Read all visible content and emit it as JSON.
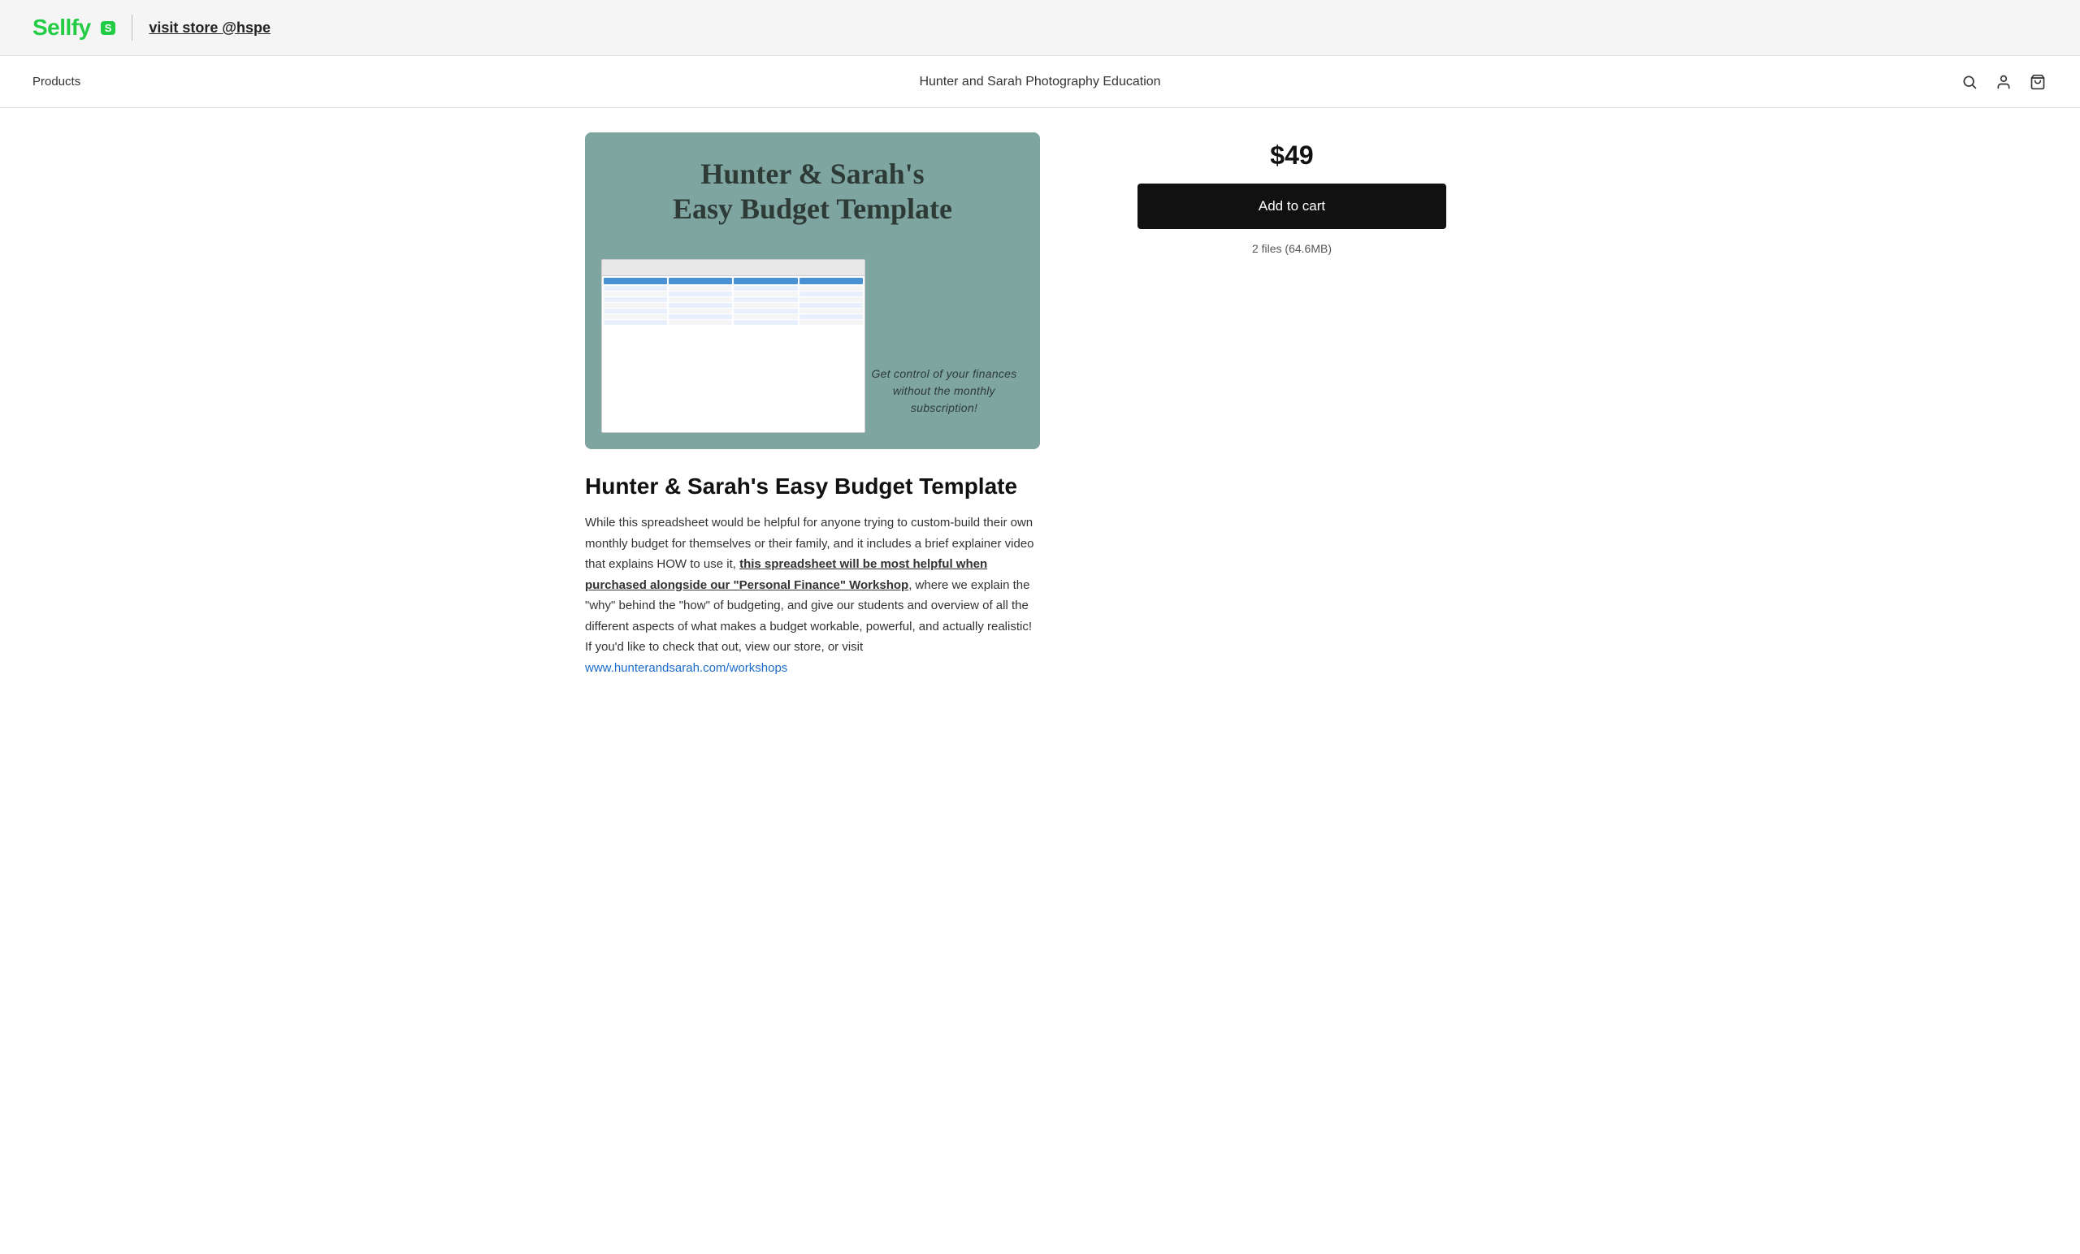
{
  "top_bar": {
    "logo_text": "Sellfy",
    "logo_badge": "S",
    "visit_store_text": "visit store @hspe"
  },
  "nav": {
    "products_label": "Products",
    "store_name": "Hunter and Sarah Photography Education"
  },
  "product": {
    "image_title_line1": "Hunter & Sarah's",
    "image_title_line2": "Easy Budget Template",
    "image_tagline": "Get control of your finances without the monthly subscription!",
    "title": "Hunter & Sarah's Easy Budget Template",
    "description_part1": "While this spreadsheet would be helpful for anyone trying to custom-build their own monthly budget for themselves or their family, and it includes a brief explainer video that explains HOW to use it, ",
    "description_bold_link": "this spreadsheet will be most helpful when purchased alongside our \"Personal Finance\" Workshop",
    "description_part2": ", where we explain the \"why\" behind the \"how\" of budgeting, and give our students and overview of all the different aspects of what makes a budget workable, powerful, and actually realistic! If you'd like to check that out, view our store, or visit ",
    "description_url": "www.hunterandsarah.com/workshops",
    "price": "$49",
    "add_to_cart_label": "Add to cart",
    "files_info": "2 files (64.6MB)"
  }
}
